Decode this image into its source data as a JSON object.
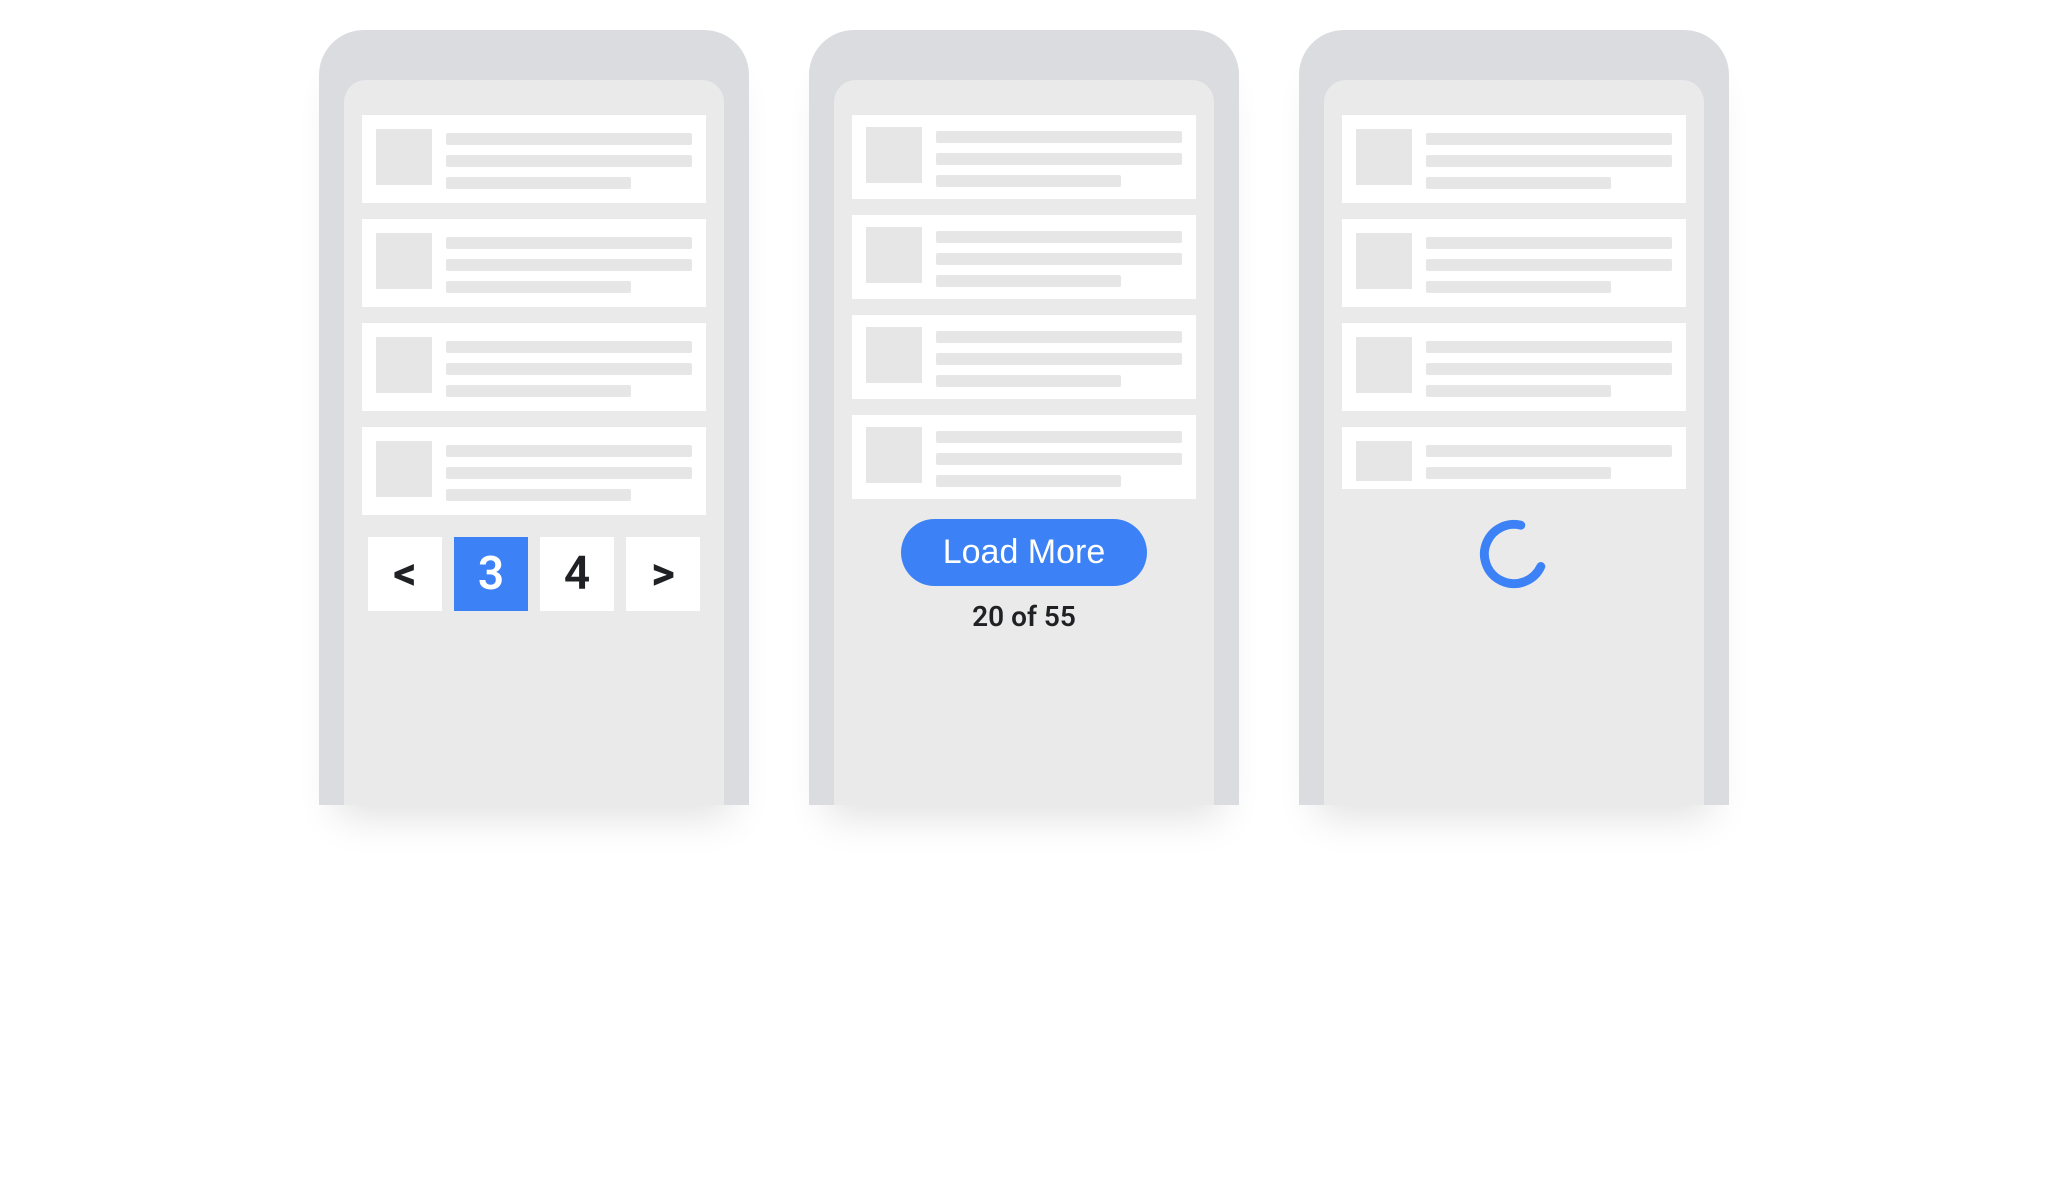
{
  "colors": {
    "accent": "#3c82f6",
    "text": "#202124",
    "device": "#dadce0",
    "screen": "#eaeaea",
    "skeleton": "#e6e6e6"
  },
  "pagination": {
    "prev_label": "<",
    "next_label": ">",
    "pages": [
      "3",
      "4"
    ],
    "active_index": 0
  },
  "loadmore": {
    "button_label": "Load More",
    "count_text": "20 of 55",
    "loaded": 20,
    "total": 55
  },
  "infinite": {
    "state": "loading"
  }
}
